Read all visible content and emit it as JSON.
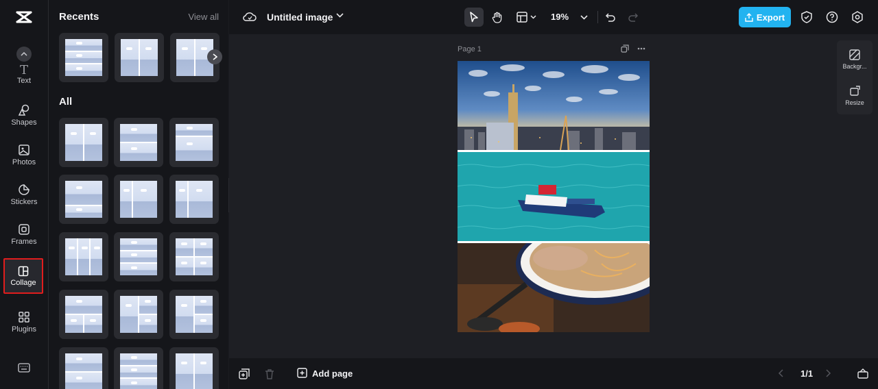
{
  "rail": {
    "items": [
      {
        "label": "Text",
        "icon": "text-icon"
      },
      {
        "label": "Shapes",
        "icon": "shapes-icon"
      },
      {
        "label": "Photos",
        "icon": "photos-icon"
      },
      {
        "label": "Stickers",
        "icon": "stickers-icon"
      },
      {
        "label": "Frames",
        "icon": "frames-icon"
      },
      {
        "label": "Collage",
        "icon": "collage-icon",
        "active": true
      },
      {
        "label": "Plugins",
        "icon": "plugins-icon"
      }
    ]
  },
  "panel": {
    "recents_title": "Recents",
    "view_all": "View all",
    "all_title": "All"
  },
  "topbar": {
    "doc_title": "Untitled image",
    "zoom": "19%",
    "export_label": "Export"
  },
  "canvas": {
    "page_label": "Page 1",
    "side_tools": [
      {
        "label": "Backgr...",
        "icon": "background-icon"
      },
      {
        "label": "Resize",
        "icon": "resize-icon"
      }
    ],
    "photos": [
      {
        "subject": "city-skyline-photo"
      },
      {
        "subject": "boat-on-sea-photo"
      },
      {
        "subject": "ramen-bowl-photo"
      }
    ]
  },
  "bottombar": {
    "add_page_label": "Add page",
    "pager": "1/1"
  },
  "colors": {
    "accent": "#22b3f0",
    "highlight": "#e21d1d",
    "background": "#1b1c21"
  }
}
